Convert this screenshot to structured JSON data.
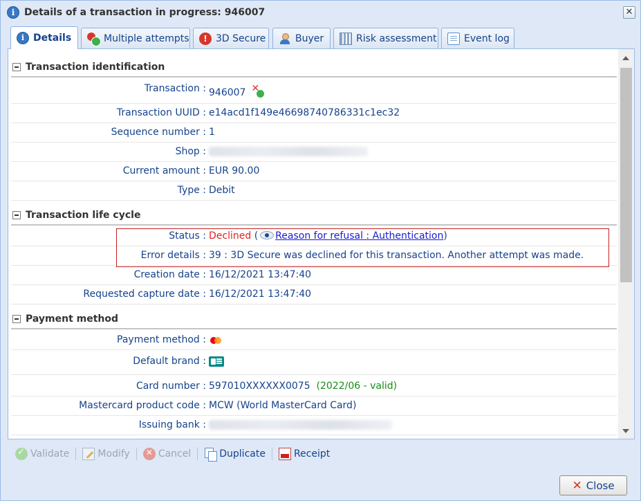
{
  "window": {
    "title": "Details of a transaction in progress: 946007",
    "close_glyph": "✕"
  },
  "tabs": [
    {
      "label": "Details",
      "icon": "info-icon",
      "active": true
    },
    {
      "label": "Multiple attempts",
      "icon": "multiple-attempts-icon",
      "active": false
    },
    {
      "label": "3D Secure",
      "icon": "exclamation-icon",
      "active": false
    },
    {
      "label": "Buyer",
      "icon": "buyer-icon",
      "active": false
    },
    {
      "label": "Risk assessment",
      "icon": "risk-assessment-icon",
      "active": false
    },
    {
      "label": "Event log",
      "icon": "event-log-icon",
      "active": false
    }
  ],
  "sections": {
    "identification": {
      "title": "Transaction identification",
      "transaction": {
        "label": "Transaction :",
        "value": "946007"
      },
      "uuid": {
        "label": "Transaction UUID :",
        "value": "e14acd1f149e46698740786331c1ec32"
      },
      "sequence": {
        "label": "Sequence number :",
        "value": "1"
      },
      "shop": {
        "label": "Shop :"
      },
      "amount": {
        "label": "Current amount :",
        "value": "EUR 90.00"
      },
      "type": {
        "label": "Type :",
        "value": "Debit"
      }
    },
    "lifecycle": {
      "title": "Transaction life cycle",
      "status": {
        "label": "Status :",
        "value": "Declined",
        "open_paren": " (",
        "reason_link": "Reason for refusal : Authentication",
        "close_paren": ")"
      },
      "error": {
        "label": "Error details :",
        "value": "39 : 3D Secure was declined for this transaction. Another attempt was made."
      },
      "creation": {
        "label": "Creation date :",
        "value": "16/12/2021 13:47:40"
      },
      "capture": {
        "label": "Requested capture date :",
        "value": "16/12/2021 13:47:40"
      }
    },
    "payment": {
      "title": "Payment method",
      "method": {
        "label": "Payment method :",
        "icon": "mastercard-icon"
      },
      "brand": {
        "label": "Default brand :",
        "icon": "cb-card-icon"
      },
      "card_number": {
        "label": "Card number :",
        "value": "597010XXXXXX0075",
        "validity": "(2022/06 - valid)"
      },
      "product_code": {
        "label": "Mastercard product code :",
        "value": "MCW (World MasterCard Card)"
      },
      "issuing_bank": {
        "label": "Issuing bank :"
      }
    }
  },
  "toolbar": {
    "validate": "Validate",
    "modify": "Modify",
    "cancel": "Cancel",
    "duplicate": "Duplicate",
    "receipt": "Receipt"
  },
  "footer": {
    "close_label": "Close"
  },
  "colors": {
    "declined": "#e02020",
    "valid": "#138f13",
    "link": "#1a1ad0",
    "highlight_border": "#c81e1e"
  }
}
